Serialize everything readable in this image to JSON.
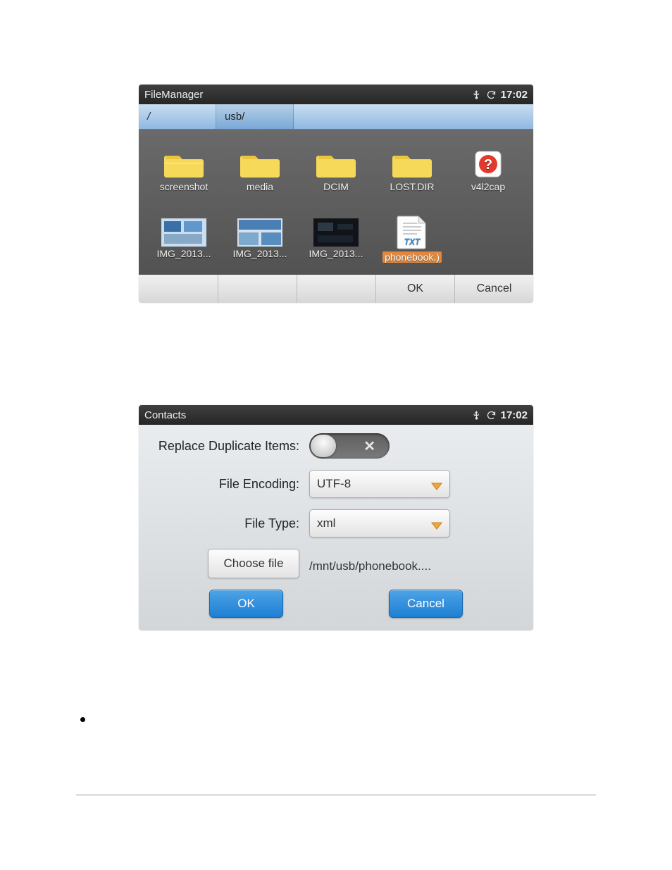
{
  "fileManager": {
    "title": "FileManager",
    "time": "17:02",
    "tabs": [
      "/",
      "usb/"
    ],
    "activeTab": 1,
    "items": [
      {
        "type": "folder",
        "label": "screenshot"
      },
      {
        "type": "folder",
        "label": "media"
      },
      {
        "type": "folder",
        "label": "DCIM"
      },
      {
        "type": "folder",
        "label": "LOST.DIR"
      },
      {
        "type": "unknown",
        "label": "v4l2cap"
      },
      {
        "type": "image",
        "label": "IMG_2013..."
      },
      {
        "type": "image",
        "label": "IMG_2013..."
      },
      {
        "type": "image",
        "label": "IMG_2013..."
      },
      {
        "type": "txt",
        "label": "phonebook.)",
        "selected": true
      }
    ],
    "footer": {
      "ok": "OK",
      "cancel": "Cancel"
    }
  },
  "contacts": {
    "title": "Contacts",
    "time": "17:02",
    "rows": {
      "replaceLabel": "Replace Duplicate Items:",
      "encodingLabel": "File Encoding:",
      "encodingValue": "UTF-8",
      "typeLabel": "File Type:",
      "typeValue": "xml",
      "chooseLabel": "Choose file",
      "filePath": "/mnt/usb/phonebook...."
    },
    "buttons": {
      "ok": "OK",
      "cancel": "Cancel"
    }
  }
}
